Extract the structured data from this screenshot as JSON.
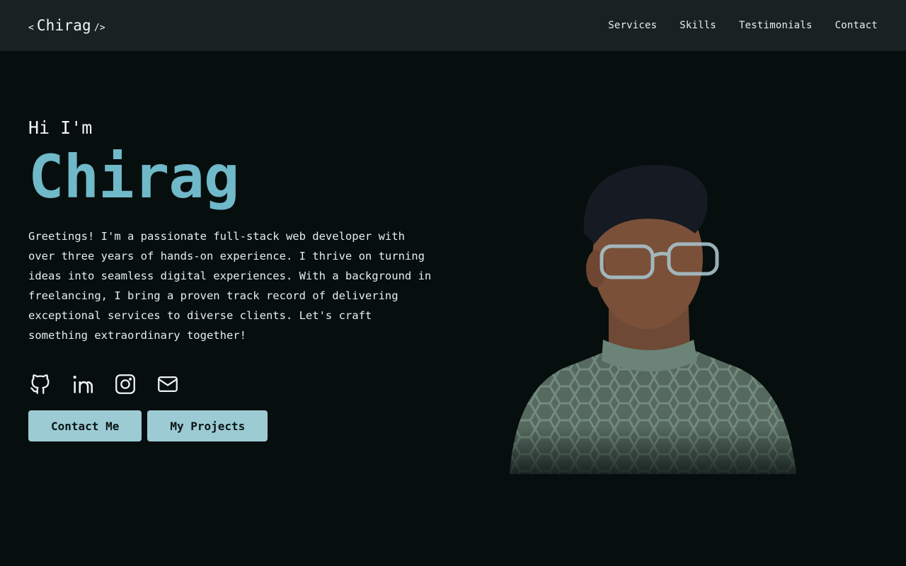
{
  "header": {
    "logo_open": "<",
    "logo_name": "Chirag",
    "logo_close": "/>",
    "nav": [
      {
        "label": "Services"
      },
      {
        "label": "Skills"
      },
      {
        "label": "Testimonials"
      },
      {
        "label": "Contact"
      }
    ]
  },
  "hero": {
    "greeting": "Hi I'm",
    "name": "Chirag",
    "bio": "Greetings! I'm a passionate full-stack web developer with over three years of hands-on experience. I thrive on turning ideas into seamless digital experiences. With a background in freelancing, I bring a proven track record of delivering exceptional services to diverse clients. Let's craft something extraordinary together!",
    "socials": [
      {
        "icon": "github-icon"
      },
      {
        "icon": "linkedin-icon"
      },
      {
        "icon": "instagram-icon"
      },
      {
        "icon": "mail-icon"
      }
    ],
    "buttons": {
      "contact": "Contact Me",
      "projects": "My Projects"
    }
  },
  "colors": {
    "background": "#070e0e",
    "header_bg": "#182223",
    "accent": "#6fb9c9",
    "button_bg": "#9ccbd4"
  }
}
